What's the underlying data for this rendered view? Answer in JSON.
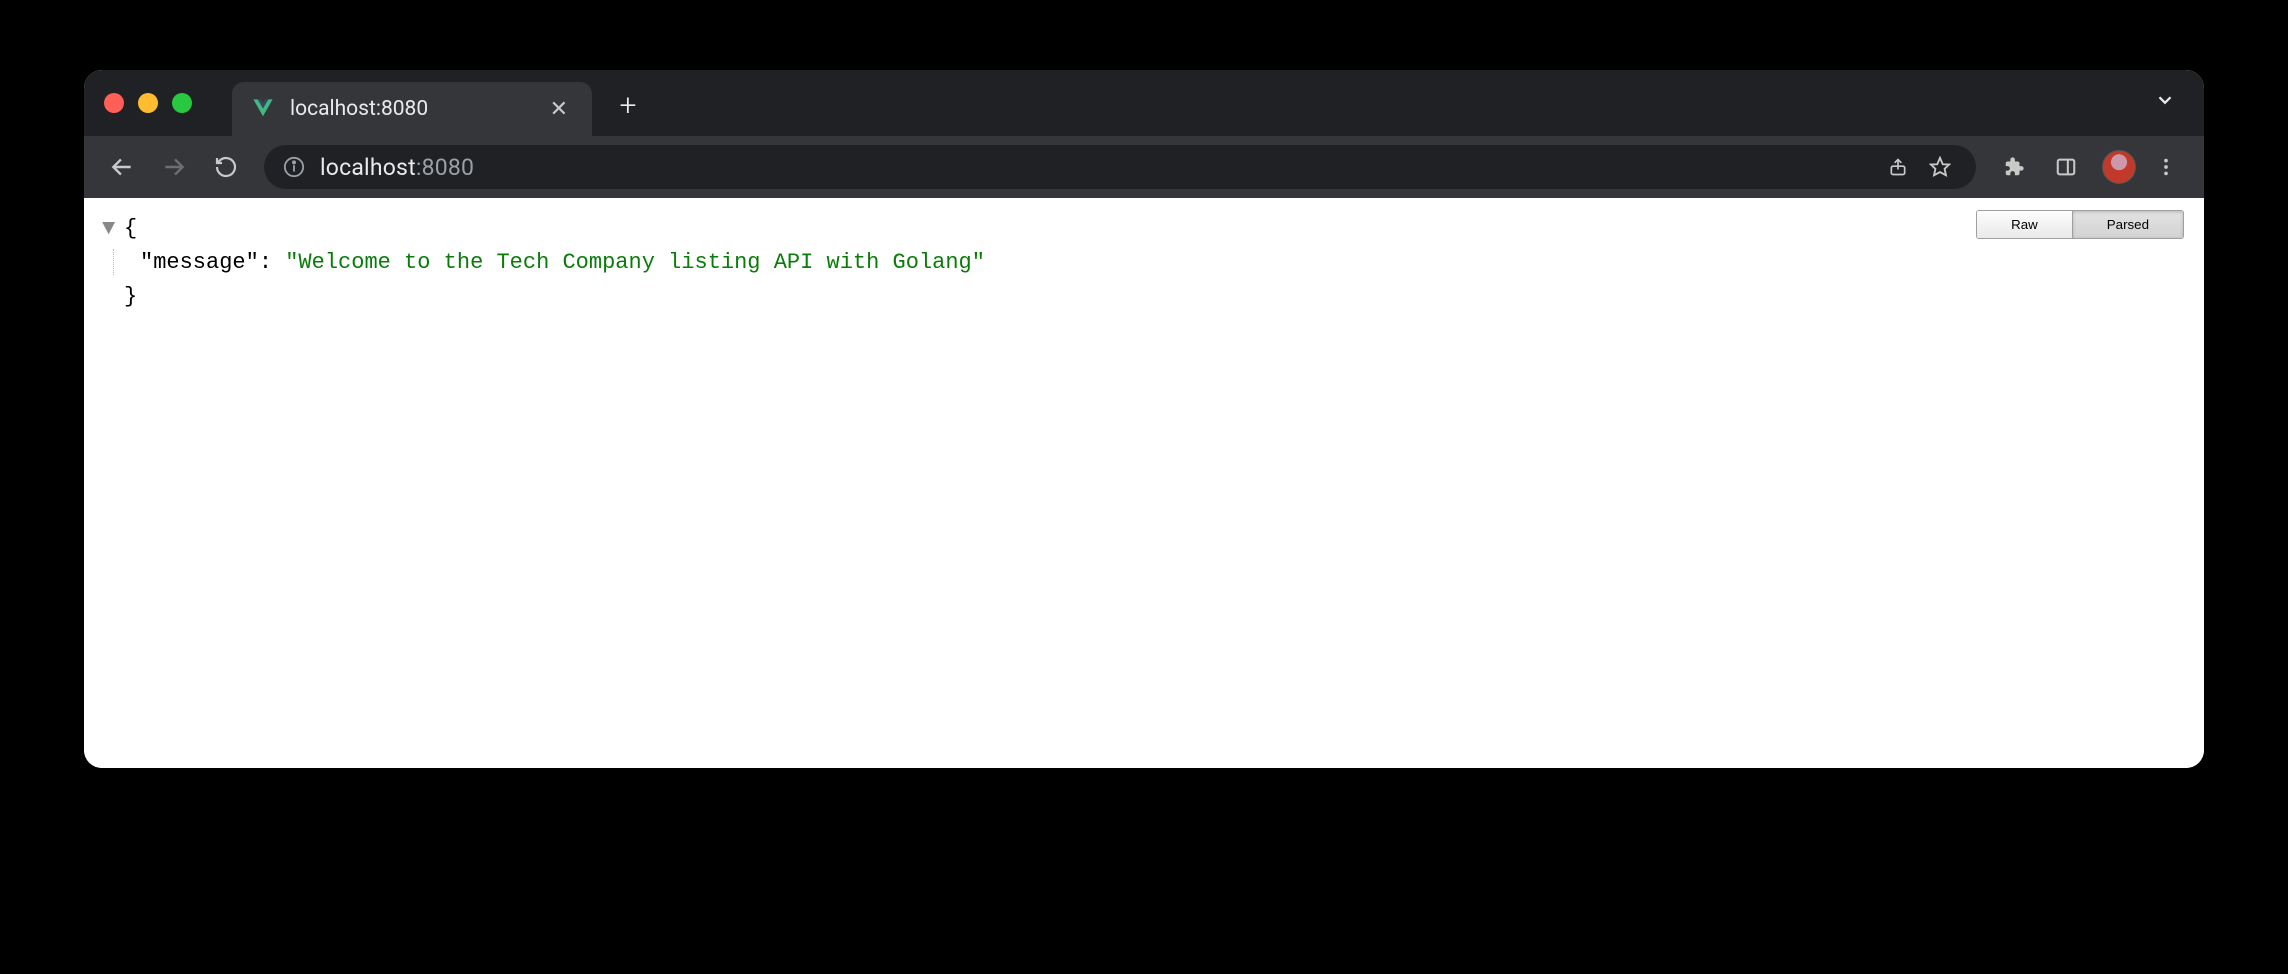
{
  "window": {
    "tab_title": "localhost:8080",
    "new_tab_label": "+"
  },
  "toolbar": {
    "url_host": "localhost",
    "url_port": ":8080"
  },
  "viewer": {
    "raw_label": "Raw",
    "parsed_label": "Parsed",
    "active_mode": "Parsed"
  },
  "json": {
    "open_brace": "{",
    "close_brace": "}",
    "key_quoted": "\"message\"",
    "colon": ":",
    "value_quoted": "\"Welcome to the Tech Company listing API with Golang\""
  }
}
